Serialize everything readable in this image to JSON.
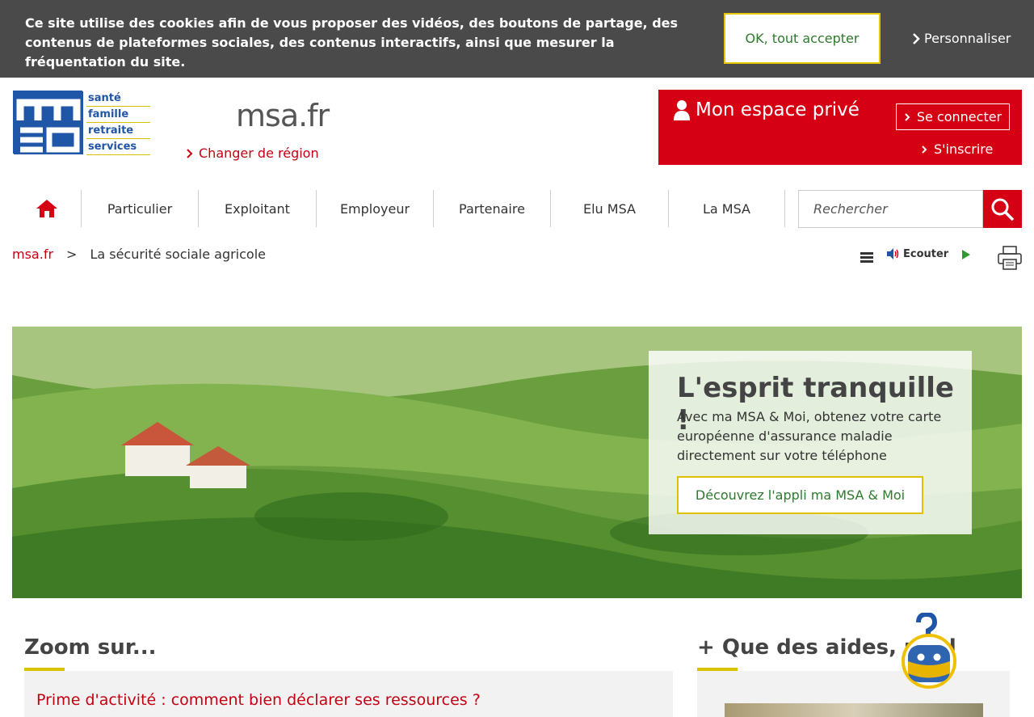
{
  "cookie": {
    "text": "Ce site utilise des cookies afin de vous proposer des vidéos, des boutons de partage, des contenus de plateformes sociales, des contenus interactifs, ainsi que mesurer la fréquentation du site.",
    "accept_label": "OK, tout accepter",
    "customize_label": "Personnaliser"
  },
  "header": {
    "logo_letters": "msa",
    "logo_words": [
      "santé",
      "famille",
      "retraite",
      "services"
    ],
    "site_name": "msa.fr",
    "region_label": "Changer de région"
  },
  "private_space": {
    "title": "Mon espace privé",
    "connect_label": "Se connecter",
    "register_label": "S'inscrire"
  },
  "nav": {
    "items": [
      "Particulier",
      "Exploitant",
      "Employeur",
      "Partenaire",
      "Elu MSA",
      "La MSA"
    ]
  },
  "search": {
    "placeholder": "Rechercher"
  },
  "breadcrumb": {
    "home": "msa.fr",
    "separator": ">",
    "current": "La sécurité sociale agricole"
  },
  "tools": {
    "listen_label": "Ecouter"
  },
  "hero": {
    "title": "L'esprit tranquille !",
    "text": "Avec ma MSA & Moi, obtenez votre carte européenne d'assurance maladie directement sur votre téléphone",
    "button_label": "Découvrez l'appli ma MSA & Moi"
  },
  "zoom": {
    "title": "Zoom sur...",
    "link": "Prime d'activité : comment bien déclarer ses ressources ?"
  },
  "aides": {
    "title": "+ Que des aides, un d"
  },
  "colors": {
    "brand_red": "#d50013",
    "accent_yellow": "#d8c200",
    "brand_blue": "#2056a8",
    "link_green": "#2d7a2d"
  }
}
